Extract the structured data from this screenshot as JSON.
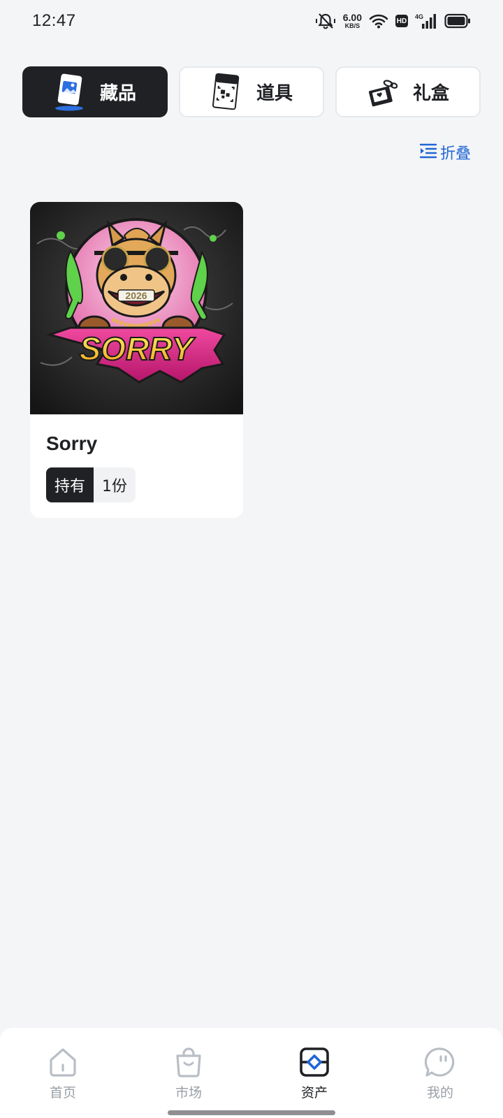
{
  "status_bar": {
    "time": "12:47",
    "net_speed_value": "6.00",
    "net_speed_unit": "KB/S",
    "hd_label": "HD",
    "network_label": "4G",
    "icons": [
      "mute-icon",
      "wifi-icon",
      "signal-icon",
      "battery-icon"
    ]
  },
  "tabs": [
    {
      "label": "藏品",
      "icon": "collection-icon",
      "active": true
    },
    {
      "label": "道具",
      "icon": "item-card-icon",
      "active": false
    },
    {
      "label": "礼盒",
      "icon": "gift-box-icon",
      "active": false
    }
  ],
  "fold": {
    "label": "折叠",
    "icon": "fold-list-icon"
  },
  "collection": [
    {
      "name": "Sorry",
      "image_text": "SORRY",
      "image_year": "2026",
      "hold_label": "持有",
      "count": "1份"
    }
  ],
  "bottom_nav": [
    {
      "label": "首页",
      "icon": "home-icon",
      "active": false
    },
    {
      "label": "市场",
      "icon": "market-bag-icon",
      "active": false
    },
    {
      "label": "资产",
      "icon": "assets-icon",
      "active": true
    },
    {
      "label": "我的",
      "icon": "profile-bubble-icon",
      "active": false
    }
  ],
  "colors": {
    "accent": "#1f66d6",
    "dark": "#1f2124",
    "background": "#f4f5f7",
    "inactive_nav": "#9aa0a6"
  }
}
